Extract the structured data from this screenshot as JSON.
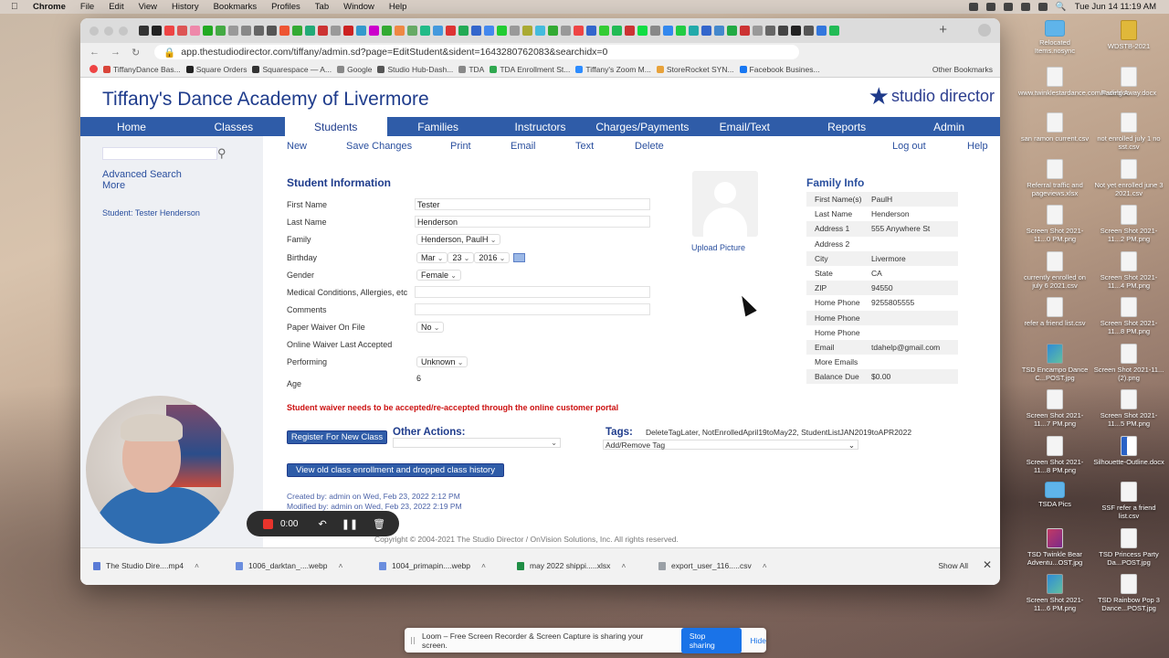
{
  "menubar": {
    "app": "Chrome",
    "items": [
      "File",
      "Edit",
      "View",
      "History",
      "Bookmarks",
      "Profiles",
      "Tab",
      "Window",
      "Help"
    ],
    "clock": "Tue Jun 14  11:19 AM"
  },
  "browser": {
    "url": "app.thestudiodirector.com/tiffany/admin.sd?page=EditStudent&sident=1643280762083&searchidx=0",
    "bookmarks": [
      {
        "label": "TiffanyDance Bas...",
        "color": "#d9453a"
      },
      {
        "label": "Square Orders",
        "color": "#222222"
      },
      {
        "label": "Squarespace — A...",
        "color": "#333333"
      },
      {
        "label": "Google",
        "color": "#888888"
      },
      {
        "label": "Studio Hub-Dash...",
        "color": "#555555"
      },
      {
        "label": "TDA",
        "color": "#888888"
      },
      {
        "label": "TDA Enrollment St...",
        "color": "#2fa84f"
      },
      {
        "label": "Tiffany's Zoom M...",
        "color": "#2d8cff"
      },
      {
        "label": "StoreRocket SYN...",
        "color": "#e8a23a"
      },
      {
        "label": "Facebook Busines...",
        "color": "#1877f2"
      }
    ],
    "other_bookmarks": "Other Bookmarks"
  },
  "site": {
    "title": "Tiffany's Dance Academy of Livermore",
    "logo_text": "studio director",
    "nav": [
      {
        "label": "Home",
        "active": false
      },
      {
        "label": "Classes",
        "active": false
      },
      {
        "label": "Students",
        "active": true
      },
      {
        "label": "Families",
        "active": false
      },
      {
        "label": "Instructors",
        "active": false
      },
      {
        "label": "Charges/Payments",
        "active": false
      },
      {
        "label": "Email/Text",
        "active": false
      },
      {
        "label": "Reports",
        "active": false
      },
      {
        "label": "Admin",
        "active": false
      }
    ],
    "toolbar": {
      "new": "New",
      "save": "Save Changes",
      "print": "Print",
      "email": "Email",
      "text": "Text",
      "delete": "Delete",
      "logout": "Log out",
      "help": "Help"
    },
    "sidebar": {
      "search_placeholder": "",
      "advanced_search": "Advanced Search",
      "more": "More",
      "student_link": "Student: Tester Henderson"
    }
  },
  "student": {
    "section_title": "Student Information",
    "first_name_label": "First Name",
    "first_name": "Tester",
    "last_name_label": "Last Name",
    "last_name": "Henderson",
    "family_label": "Family",
    "family": "Henderson, PaulH",
    "birthday_label": "Birthday",
    "birth_month": "Mar",
    "birth_day": "23",
    "birth_year": "2016",
    "gender_label": "Gender",
    "gender": "Female",
    "medical_label": "Medical Conditions, Allergies, etc",
    "medical": "",
    "comments_label": "Comments",
    "comments": "",
    "paper_waiver_label": "Paper Waiver On File",
    "paper_waiver": "No",
    "online_waiver_label": "Online Waiver Last Accepted",
    "performing_label": "Performing",
    "performing": "Unknown",
    "age_label": "Age",
    "age": "6",
    "upload_picture": "Upload Picture",
    "waiver_warning": "Student waiver needs to be accepted/re-accepted through the online customer portal",
    "register_button": "Register For New Class",
    "other_actions_title": "Other Actions:",
    "tags_title": "Tags:",
    "tags": "DeleteTagLater, NotEnrolledApril19toMay22, StudentListJAN2019toAPR2022",
    "add_remove_tag": "Add/Remove Tag",
    "history_button": "View old class enrollment and dropped class history",
    "created": "Created by: admin on Wed, Feb 23, 2022 2:12 PM",
    "modified": "Modified by: admin on Wed, Feb 23, 2022 2:19 PM",
    "copyright": "Copyright © 2004-2021 The Studio Director / OnVision Solutions, Inc. All rights reserved."
  },
  "family": {
    "title": "Family Info",
    "rows": [
      {
        "k": "First Name(s)",
        "v": "PaulH"
      },
      {
        "k": "Last Name",
        "v": "Henderson"
      },
      {
        "k": "Address 1",
        "v": "555 Anywhere St"
      },
      {
        "k": "Address 2",
        "v": ""
      },
      {
        "k": "City",
        "v": "Livermore"
      },
      {
        "k": "State",
        "v": "CA"
      },
      {
        "k": "ZIP",
        "v": "94550"
      },
      {
        "k": "Home Phone",
        "v": "9255805555"
      },
      {
        "k": "Home Phone",
        "v": ""
      },
      {
        "k": "Home Phone",
        "v": ""
      },
      {
        "k": "Email",
        "v": "tdahelp@gmail.com"
      },
      {
        "k": "More Emails",
        "v": ""
      },
      {
        "k": "Balance Due",
        "v": "$0.00"
      }
    ]
  },
  "downloads": {
    "items": [
      {
        "name": "The Studio Dire....mp4",
        "color": "#5a7bd6"
      },
      {
        "name": "1006_darktan_....webp",
        "color": "#6b8ede"
      },
      {
        "name": "1004_primapin....webp",
        "color": "#6b8ede"
      },
      {
        "name": "may 2022 shippi.....xlsx",
        "color": "#1f8e45"
      },
      {
        "name": "export_user_116.....csv",
        "color": "#9aa0a6"
      }
    ],
    "show_all": "Show All"
  },
  "recorder": {
    "time": "0:00"
  },
  "desktop_icons": [
    {
      "label": "Relocated Items.nosync",
      "type": "folder"
    },
    {
      "label": "WDSTB-2021",
      "type": "yellow"
    },
    {
      "label": "www.twinklestardance.com/#.webloc",
      "type": "doc"
    },
    {
      "label": "Fading Away.docx",
      "type": "doc"
    },
    {
      "label": "san ramon current.csv",
      "type": "doc"
    },
    {
      "label": "not enrolled july 1 no sst.csv",
      "type": "doc"
    },
    {
      "label": "Referral traffic and pageviews.xlsx",
      "type": "doc"
    },
    {
      "label": "Not yet enrolled june 3 2021.csv",
      "type": "doc"
    },
    {
      "label": "Screen Shot 2021-11...0 PM.png",
      "type": "doc"
    },
    {
      "label": "Screen Shot 2021-11...2 PM.png",
      "type": "doc"
    },
    {
      "label": "currently enrolled on july 6 2021.csv",
      "type": "doc"
    },
    {
      "label": "Screen Shot 2021-11...4 PM.png",
      "type": "doc"
    },
    {
      "label": "refer a friend list.csv",
      "type": "doc"
    },
    {
      "label": "Screen Shot 2021-11...8 PM.png",
      "type": "doc"
    },
    {
      "label": "TSD Encampo Dance C...POST.jpg",
      "type": "img"
    },
    {
      "label": "Screen Shot 2021-11...(2).png",
      "type": "doc"
    },
    {
      "label": "Screen Shot 2021-11...7 PM.png",
      "type": "doc"
    },
    {
      "label": "Screen Shot 2021-11...5 PM.png",
      "type": "doc"
    },
    {
      "label": "Screen Shot 2021-11...8 PM.png",
      "type": "doc"
    },
    {
      "label": "Silhouette-Outline.docx",
      "type": "word"
    },
    {
      "label": "TSDA Pics",
      "type": "folder"
    },
    {
      "label": "SSF refer a friend list.csv",
      "type": "doc"
    },
    {
      "label": "TSD Twinkle Bear Adventu...OST.jpg",
      "type": "mag"
    },
    {
      "label": "TSD Princess Party Da...POST.jpg",
      "type": "doc"
    },
    {
      "label": "Screen Shot 2021-11...6 PM.png",
      "type": "img"
    },
    {
      "label": "TSD Rainbow Pop 3 Dance...POST.jpg",
      "type": "doc"
    }
  ],
  "loom": {
    "message": "Loom – Free Screen Recorder & Screen Capture is sharing your screen.",
    "stop": "Stop sharing",
    "hide": "Hide"
  }
}
